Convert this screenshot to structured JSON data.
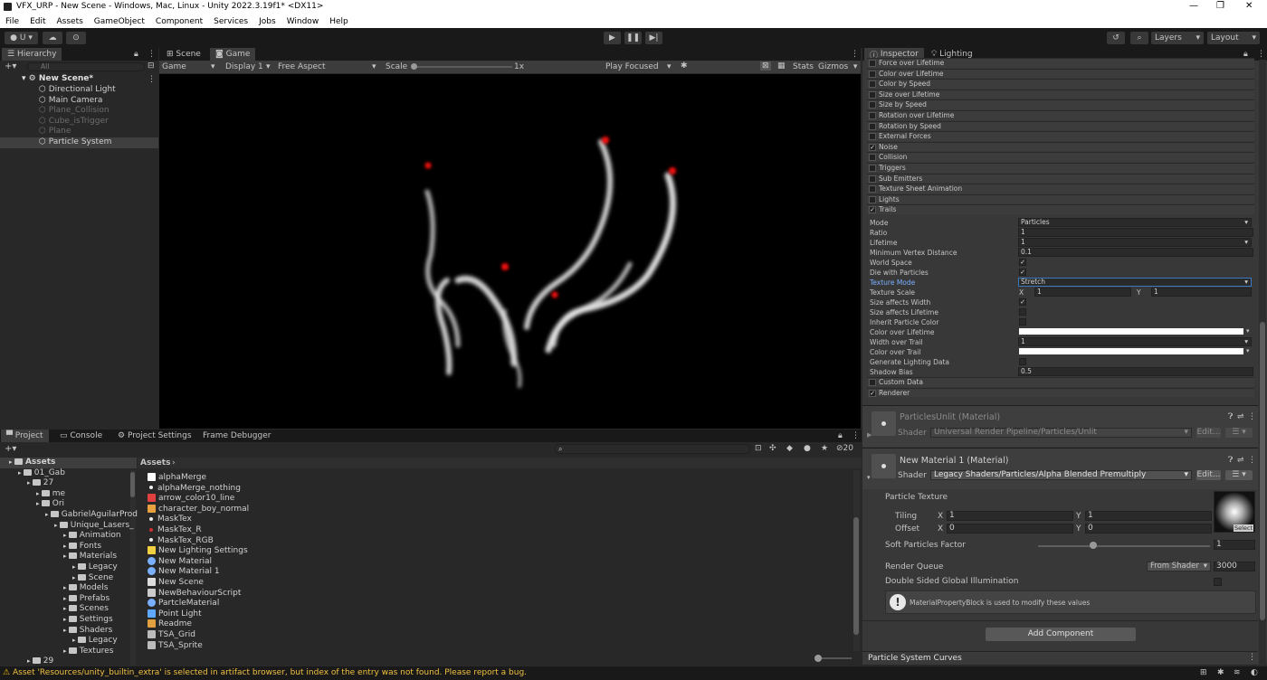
{
  "window": {
    "title": "VFX_URP - New Scene - Windows, Mac, Linux - Unity 2022.3.19f1* <DX11>"
  },
  "menu": [
    "File",
    "Edit",
    "Assets",
    "GameObject",
    "Component",
    "Services",
    "Jobs",
    "Window",
    "Help"
  ],
  "toolbar": {
    "account": "U",
    "layers": "Layers",
    "layout": "Layout"
  },
  "hierarchy": {
    "tab": "Hierarchy",
    "search_placeholder": "All",
    "scene": "New Scene*",
    "items": [
      {
        "label": "Directional Light",
        "dim": false
      },
      {
        "label": "Main Camera",
        "dim": false
      },
      {
        "label": "Plane_Collision",
        "dim": true
      },
      {
        "label": "Cube_isTrigger",
        "dim": true
      },
      {
        "label": "Plane",
        "dim": true
      },
      {
        "label": "Particle System",
        "dim": false
      }
    ]
  },
  "viewtabs": {
    "scene": "Scene",
    "game": "Game"
  },
  "gamebar": {
    "mode": "Game",
    "display": "Display 1",
    "aspect": "Free Aspect",
    "scale_label": "Scale",
    "scale_value": "1x",
    "play_focused": "Play Focused",
    "stats": "Stats",
    "gizmos": "Gizmos"
  },
  "inspector": {
    "tab": "Inspector",
    "lighting_tab": "Lighting",
    "modules": [
      {
        "label": "Force over Lifetime",
        "checked": false
      },
      {
        "label": "Color over Lifetime",
        "checked": false
      },
      {
        "label": "Color by Speed",
        "checked": false
      },
      {
        "label": "Size over Lifetime",
        "checked": false
      },
      {
        "label": "Size by Speed",
        "checked": false
      },
      {
        "label": "Rotation over Lifetime",
        "checked": false
      },
      {
        "label": "Rotation by Speed",
        "checked": false
      },
      {
        "label": "External Forces",
        "checked": false
      },
      {
        "label": "Noise",
        "checked": true
      },
      {
        "label": "Collision",
        "checked": false
      },
      {
        "label": "Triggers",
        "checked": false
      },
      {
        "label": "Sub Emitters",
        "checked": false
      },
      {
        "label": "Texture Sheet Animation",
        "checked": false
      },
      {
        "label": "Lights",
        "checked": false
      },
      {
        "label": "Trails",
        "checked": true
      }
    ],
    "trails": {
      "mode_label": "Mode",
      "mode_value": "Particles",
      "ratio_label": "Ratio",
      "ratio_value": "1",
      "lifetime_label": "Lifetime",
      "lifetime_value": "1",
      "min_vertex_label": "Minimum Vertex Distance",
      "min_vertex_value": "0.1",
      "world_space_label": "World Space",
      "die_label": "Die with Particles",
      "texture_mode_label": "Texture Mode",
      "texture_mode_value": "Stretch",
      "texture_scale_label": "Texture Scale",
      "ts_x": "1",
      "ts_y": "1",
      "size_width_label": "Size affects Width",
      "size_lifetime_label": "Size affects Lifetime",
      "inherit_label": "Inherit Particle Color",
      "color_lifetime_label": "Color over Lifetime",
      "width_trail_label": "Width over Trail",
      "width_trail_value": "1",
      "color_trail_label": "Color over Trail",
      "gen_light_label": "Generate Lighting Data",
      "shadow_bias_label": "Shadow Bias",
      "shadow_bias_value": "0.5"
    },
    "modules_after": [
      {
        "label": "Custom Data",
        "checked": false
      },
      {
        "label": "Renderer",
        "checked": true
      }
    ],
    "mat1": {
      "name": "ParticlesUnlit (Material)",
      "shader_label": "Shader",
      "shader": "Universal Render Pipeline/Particles/Unlit",
      "edit": "Edit..."
    },
    "mat2": {
      "name": "New Material 1 (Material)",
      "shader_label": "Shader",
      "shader": "Legacy Shaders/Particles/Alpha Blended Premultiply",
      "edit": "Edit..."
    },
    "particle_texture": "Particle Texture",
    "tiling_label": "Tiling",
    "tiling_x": "1",
    "tiling_y": "1",
    "offset_label": "Offset",
    "offset_x": "0",
    "offset_y": "0",
    "select": "Select",
    "soft_label": "Soft Particles Factor",
    "soft_value": "1",
    "soft_fraction": 0.3,
    "render_queue_label": "Render Queue",
    "render_queue_mode": "From Shader",
    "render_queue_value": "3000",
    "dsgi_label": "Double Sided Global Illumination",
    "info": "MaterialPropertyBlock is used to modify these values",
    "add_component": "Add Component",
    "curves": "Particle System Curves"
  },
  "bottom": {
    "tabs": [
      "Project",
      "Console",
      "Project Settings",
      "Frame Debugger"
    ],
    "assets_header": "Assets",
    "breadcrumb": "Assets",
    "count": "20",
    "tree": [
      {
        "label": "Assets",
        "indent": 0,
        "bold": true
      },
      {
        "label": "01_Gab",
        "indent": 1
      },
      {
        "label": "27",
        "indent": 2
      },
      {
        "label": "me",
        "indent": 3
      },
      {
        "label": "Ori",
        "indent": 3
      },
      {
        "label": "GabrielAguilarProd",
        "indent": 4
      },
      {
        "label": "Unique_Lasers_",
        "indent": 5
      },
      {
        "label": "Animation",
        "indent": 6
      },
      {
        "label": "Fonts",
        "indent": 6
      },
      {
        "label": "Materials",
        "indent": 6
      },
      {
        "label": "Legacy",
        "indent": 7
      },
      {
        "label": "Scene",
        "indent": 7
      },
      {
        "label": "Models",
        "indent": 6
      },
      {
        "label": "Prefabs",
        "indent": 6
      },
      {
        "label": "Scenes",
        "indent": 6
      },
      {
        "label": "Settings",
        "indent": 6
      },
      {
        "label": "Shaders",
        "indent": 6
      },
      {
        "label": "Legacy",
        "indent": 7
      },
      {
        "label": "Textures",
        "indent": 6
      },
      {
        "label": "29",
        "indent": 2
      }
    ],
    "files": [
      {
        "label": "alphaMerge",
        "icon": "white-square-icon"
      },
      {
        "label": "alphaMerge_nothing",
        "icon": "dot-icon"
      },
      {
        "label": "arrow_color10_line",
        "icon": "red-arrow-icon"
      },
      {
        "label": "character_boy_normal",
        "icon": "prefab-icon"
      },
      {
        "label": "MaskTex",
        "icon": "dot-icon"
      },
      {
        "label": "MaskTex_R",
        "icon": "red-dot-icon"
      },
      {
        "label": "MaskTex_RGB",
        "icon": "dot-icon"
      },
      {
        "label": "New Lighting Settings",
        "icon": "lighting-icon"
      },
      {
        "label": "New Material",
        "icon": "material-icon"
      },
      {
        "label": "New Material 1",
        "icon": "material-icon"
      },
      {
        "label": "New Scene",
        "icon": "scene-icon"
      },
      {
        "label": "NewBehaviourScript",
        "icon": "script-icon"
      },
      {
        "label": "PartcleMaterial",
        "icon": "material-icon"
      },
      {
        "label": "Point Light",
        "icon": "cube-icon"
      },
      {
        "label": "Readme",
        "icon": "readme-icon"
      },
      {
        "label": "TSA_Grid",
        "icon": "grid-icon"
      },
      {
        "label": "TSA_Sprite",
        "icon": "grid-icon"
      }
    ]
  },
  "status": {
    "message": "Asset 'Resources/unity_builtin_extra' is selected in artifact browser, but index of the entry was not found. Please report a bug."
  }
}
